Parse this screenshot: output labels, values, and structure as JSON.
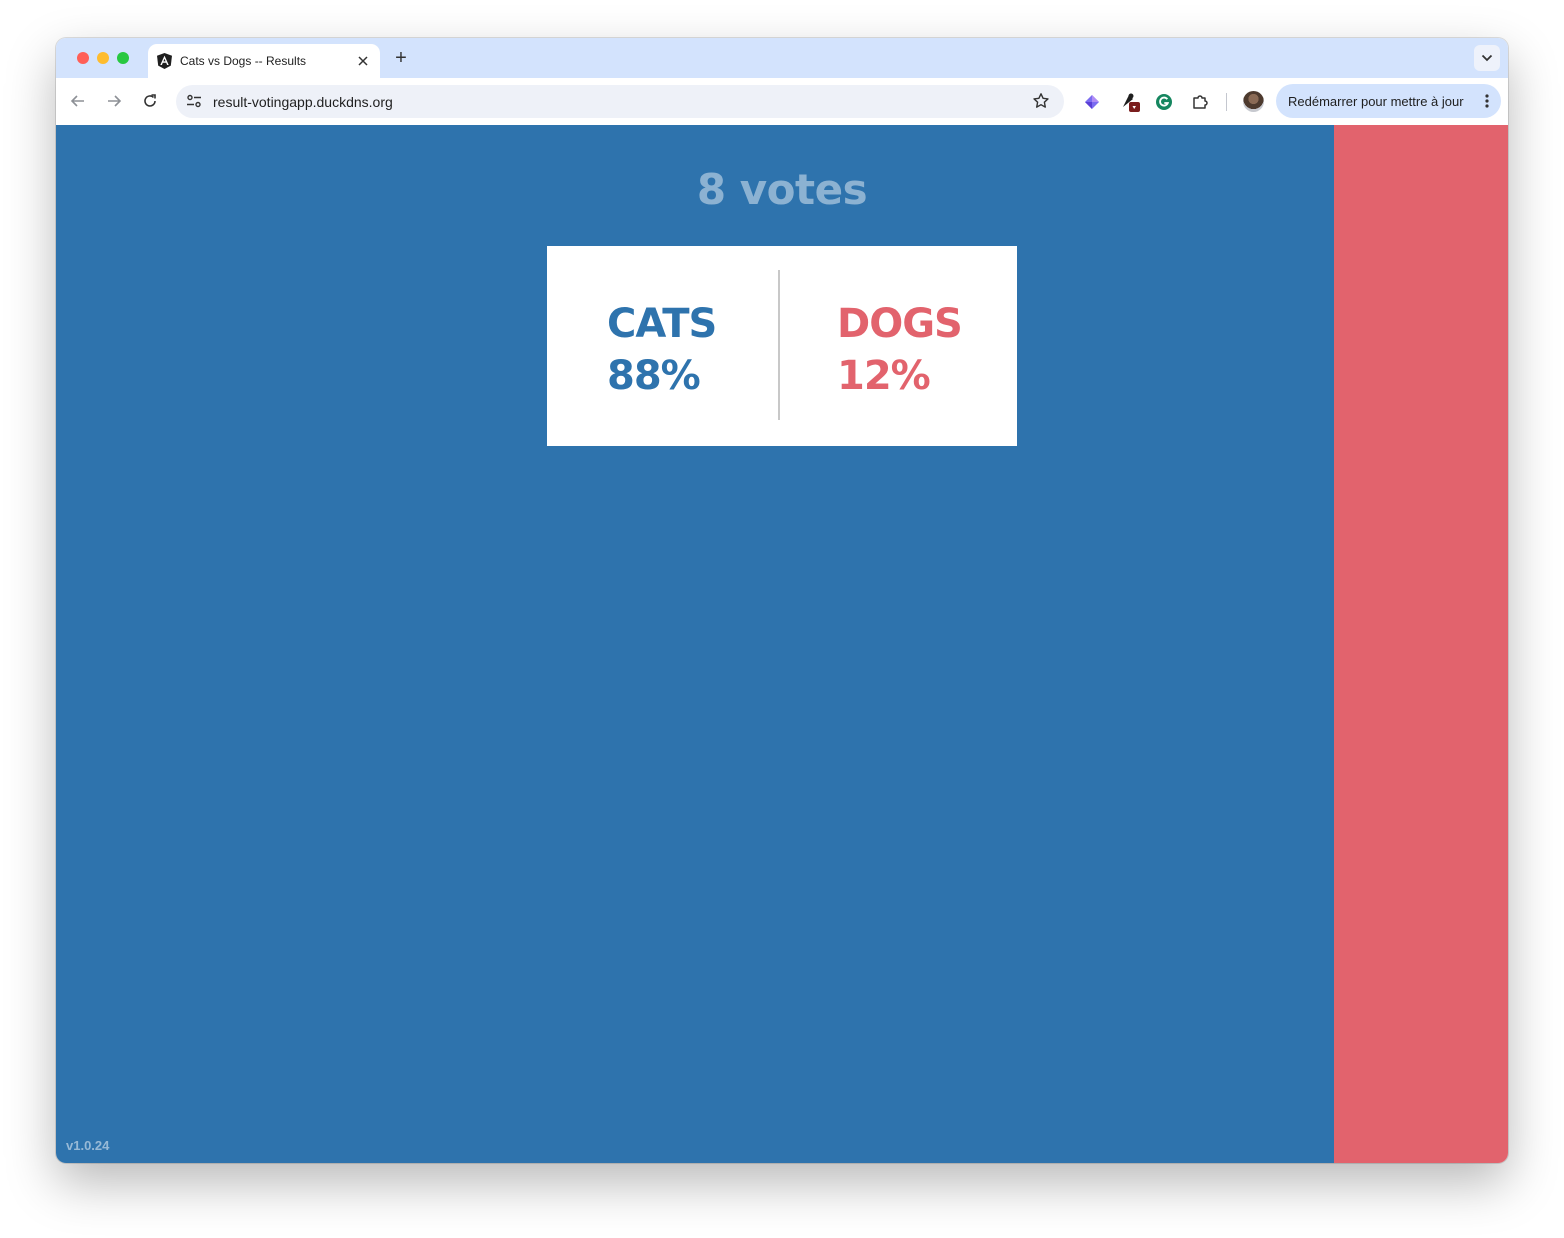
{
  "browser": {
    "tab_title": "Cats vs Dogs -- Results",
    "new_tab": "+",
    "url": "result-votingapp.duckdns.org",
    "update_button": "Redémarrer pour mettre à jour"
  },
  "results": {
    "vote_count": "8 votes",
    "cats": {
      "label": "CATS",
      "percent": "88%",
      "share": 0.88
    },
    "dogs": {
      "label": "DOGS",
      "percent": "12%",
      "share": 0.12
    },
    "version": "v1.0.24"
  },
  "colors": {
    "cats": "#2e73ad",
    "dogs": "#e2636d"
  },
  "icons": [
    "angular-logo-icon",
    "close-icon",
    "back-arrow-icon",
    "forward-arrow-icon",
    "reload-icon",
    "site-settings-icon",
    "bookmark-star-icon",
    "extension-gem-icon",
    "extension-pin-icon",
    "grammarly-icon",
    "puzzle-extensions-icon",
    "kebab-menu-icon",
    "chevron-down-icon"
  ]
}
